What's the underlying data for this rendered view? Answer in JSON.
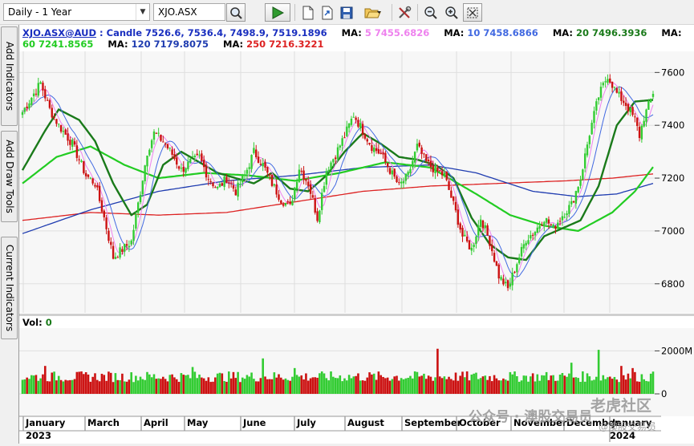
{
  "toolbar": {
    "period": "Daily - 1 Year",
    "symbol": "XJO.ASX"
  },
  "side_tabs": [
    "Add Indicators",
    "Add Draw Tools",
    "Current Indicators"
  ],
  "header": {
    "symbol": "XJO.ASX@AUD",
    "candle": "Candle 7526.6, 7536.4, 7498.9, 7519.1896",
    "ma_label": "MA:",
    "ma5": "5 7455.6826",
    "ma10": "10 7458.6866",
    "ma20": "20 7496.3936",
    "ma60": "60 7241.8565",
    "ma120": "120 7179.8075",
    "ma250": "250 7216.3221"
  },
  "colors": {
    "ma5": "#ee82ee",
    "ma10": "#4169e1",
    "ma20": "#1a7a1a",
    "ma60": "#22cc22",
    "ma120": "#1f3cb0",
    "ma250": "#dd2222",
    "up": "#33cc33",
    "down": "#cc1111"
  },
  "volume_label": "Vol:",
  "volume_value": "0",
  "watermark": {
    "wechat": "公众号 · 澳股交易员",
    "brand": "老虎社区",
    "author": "@澳股交易员"
  },
  "chart_data": {
    "type": "candlestick",
    "price_axis": [
      6800,
      7000,
      7200,
      7400,
      7600
    ],
    "price_range": [
      6690,
      7680
    ],
    "volume_axis": [
      "0",
      "2000M"
    ],
    "volume_range_m": [
      0,
      2800
    ],
    "months": [
      "January",
      "March",
      "April",
      "May",
      "June",
      "July",
      "August",
      "September",
      "October",
      "November",
      "December",
      "January"
    ],
    "years": [
      "2023",
      "2024"
    ],
    "price_keypoints": [
      [
        0,
        7450
      ],
      [
        5,
        7520
      ],
      [
        8,
        7560
      ],
      [
        12,
        7460
      ],
      [
        16,
        7400
      ],
      [
        22,
        7330
      ],
      [
        28,
        7210
      ],
      [
        32,
        7180
      ],
      [
        36,
        7050
      ],
      [
        40,
        6900
      ],
      [
        44,
        6930
      ],
      [
        48,
        6960
      ],
      [
        52,
        7150
      ],
      [
        55,
        7300
      ],
      [
        58,
        7370
      ],
      [
        62,
        7340
      ],
      [
        66,
        7290
      ],
      [
        70,
        7230
      ],
      [
        74,
        7260
      ],
      [
        78,
        7280
      ],
      [
        82,
        7200
      ],
      [
        86,
        7160
      ],
      [
        90,
        7200
      ],
      [
        94,
        7150
      ],
      [
        98,
        7210
      ],
      [
        102,
        7300
      ],
      [
        106,
        7250
      ],
      [
        110,
        7180
      ],
      [
        114,
        7120
      ],
      [
        118,
        7090
      ],
      [
        122,
        7240
      ],
      [
        126,
        7180
      ],
      [
        130,
        7050
      ],
      [
        134,
        7230
      ],
      [
        138,
        7290
      ],
      [
        142,
        7360
      ],
      [
        146,
        7440
      ],
      [
        150,
        7380
      ],
      [
        154,
        7320
      ],
      [
        158,
        7290
      ],
      [
        162,
        7230
      ],
      [
        166,
        7170
      ],
      [
        170,
        7210
      ],
      [
        174,
        7320
      ],
      [
        178,
        7260
      ],
      [
        182,
        7230
      ],
      [
        186,
        7210
      ],
      [
        190,
        7100
      ],
      [
        194,
        6980
      ],
      [
        198,
        6930
      ],
      [
        202,
        7050
      ],
      [
        206,
        6960
      ],
      [
        210,
        6830
      ],
      [
        214,
        6780
      ],
      [
        218,
        6880
      ],
      [
        222,
        6970
      ],
      [
        226,
        7000
      ],
      [
        230,
        7050
      ],
      [
        234,
        7010
      ],
      [
        238,
        7060
      ],
      [
        242,
        7100
      ],
      [
        246,
        7200
      ],
      [
        250,
        7370
      ],
      [
        254,
        7510
      ],
      [
        258,
        7590
      ],
      [
        262,
        7520
      ],
      [
        266,
        7480
      ],
      [
        270,
        7420
      ],
      [
        272,
        7360
      ],
      [
        274,
        7430
      ],
      [
        278,
        7519
      ]
    ],
    "ma20_keypoints": [
      [
        0,
        7230
      ],
      [
        10,
        7380
      ],
      [
        16,
        7460
      ],
      [
        25,
        7420
      ],
      [
        32,
        7340
      ],
      [
        40,
        7180
      ],
      [
        48,
        7060
      ],
      [
        55,
        7100
      ],
      [
        62,
        7250
      ],
      [
        70,
        7300
      ],
      [
        78,
        7260
      ],
      [
        86,
        7220
      ],
      [
        94,
        7200
      ],
      [
        102,
        7180
      ],
      [
        110,
        7220
      ],
      [
        118,
        7160
      ],
      [
        126,
        7150
      ],
      [
        134,
        7210
      ],
      [
        142,
        7300
      ],
      [
        150,
        7370
      ],
      [
        158,
        7330
      ],
      [
        166,
        7280
      ],
      [
        174,
        7270
      ],
      [
        182,
        7250
      ],
      [
        190,
        7200
      ],
      [
        198,
        7050
      ],
      [
        206,
        6950
      ],
      [
        214,
        6900
      ],
      [
        222,
        6890
      ],
      [
        230,
        6980
      ],
      [
        238,
        7010
      ],
      [
        246,
        7040
      ],
      [
        254,
        7170
      ],
      [
        262,
        7400
      ],
      [
        270,
        7490
      ],
      [
        278,
        7496
      ]
    ],
    "ma60_keypoints": [
      [
        0,
        7180
      ],
      [
        15,
        7280
      ],
      [
        30,
        7320
      ],
      [
        45,
        7250
      ],
      [
        60,
        7200
      ],
      [
        80,
        7220
      ],
      [
        100,
        7210
      ],
      [
        120,
        7190
      ],
      [
        140,
        7220
      ],
      [
        160,
        7260
      ],
      [
        180,
        7240
      ],
      [
        200,
        7140
      ],
      [
        215,
        7060
      ],
      [
        230,
        7020
      ],
      [
        245,
        7000
      ],
      [
        260,
        7070
      ],
      [
        270,
        7150
      ],
      [
        278,
        7242
      ]
    ],
    "ma120_keypoints": [
      [
        0,
        6990
      ],
      [
        30,
        7080
      ],
      [
        60,
        7150
      ],
      [
        90,
        7190
      ],
      [
        120,
        7210
      ],
      [
        150,
        7240
      ],
      [
        180,
        7250
      ],
      [
        200,
        7220
      ],
      [
        225,
        7150
      ],
      [
        245,
        7130
      ],
      [
        262,
        7140
      ],
      [
        278,
        7180
      ]
    ],
    "ma250_keypoints": [
      [
        0,
        7040
      ],
      [
        30,
        7070
      ],
      [
        60,
        7060
      ],
      [
        90,
        7070
      ],
      [
        120,
        7110
      ],
      [
        150,
        7150
      ],
      [
        180,
        7170
      ],
      [
        210,
        7180
      ],
      [
        240,
        7190
      ],
      [
        260,
        7200
      ],
      [
        278,
        7216
      ]
    ]
  }
}
